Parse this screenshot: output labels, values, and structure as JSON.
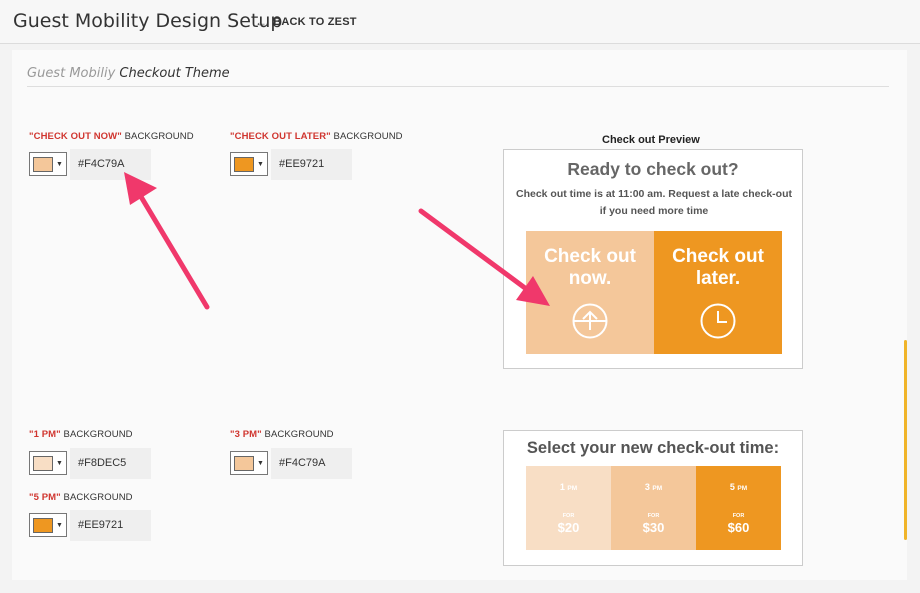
{
  "header": {
    "title": "Guest Mobility Design Setup",
    "back_label": "BACK TO ZEST"
  },
  "section": {
    "prefix": "Guest Mobiliy",
    "title": "Checkout Theme"
  },
  "fields": {
    "now": {
      "label_red": "\"CHECK OUT NOW\"",
      "label_rest": " BACKGROUND",
      "hex": "#F4C79A",
      "color": "#F4C79A"
    },
    "later": {
      "label_red": "\"CHECK OUT LATER\"",
      "label_rest": " BACKGROUND",
      "hex": "#EE9721",
      "color": "#EE9721"
    },
    "pm1": {
      "label_red": "\"1 PM\"",
      "label_rest": " BACKGROUND",
      "hex": "#F8DEC5",
      "color": "#F8DEC5"
    },
    "pm3": {
      "label_red": "\"3 PM\"",
      "label_rest": " BACKGROUND",
      "hex": "#F4C79A",
      "color": "#F4C79A"
    },
    "pm5": {
      "label_red": "\"5 PM\"",
      "label_rest": " BACKGROUND",
      "hex": "#EE9721",
      "color": "#EE9721"
    }
  },
  "preview": {
    "title": "Check out Preview",
    "heading": "Ready to check out?",
    "subtext": "Check out time is at 11:00 am. Request a late check-out if you need more time",
    "now_label": "Check out now.",
    "later_label": "Check out later."
  },
  "time_select": {
    "heading": "Select your new check-out time:",
    "slots": [
      {
        "hour": "1",
        "suffix": "PM",
        "for": "FOR",
        "price": "$20",
        "color": "#F8DEC5"
      },
      {
        "hour": "3",
        "suffix": "PM",
        "for": "FOR",
        "price": "$30",
        "color": "#F4C79A"
      },
      {
        "hour": "5",
        "suffix": "PM",
        "for": "FOR",
        "price": "$60",
        "color": "#EE9721"
      }
    ]
  },
  "colors": {
    "accent_red": "#D0352F",
    "annotation_pink": "#F0386B"
  }
}
